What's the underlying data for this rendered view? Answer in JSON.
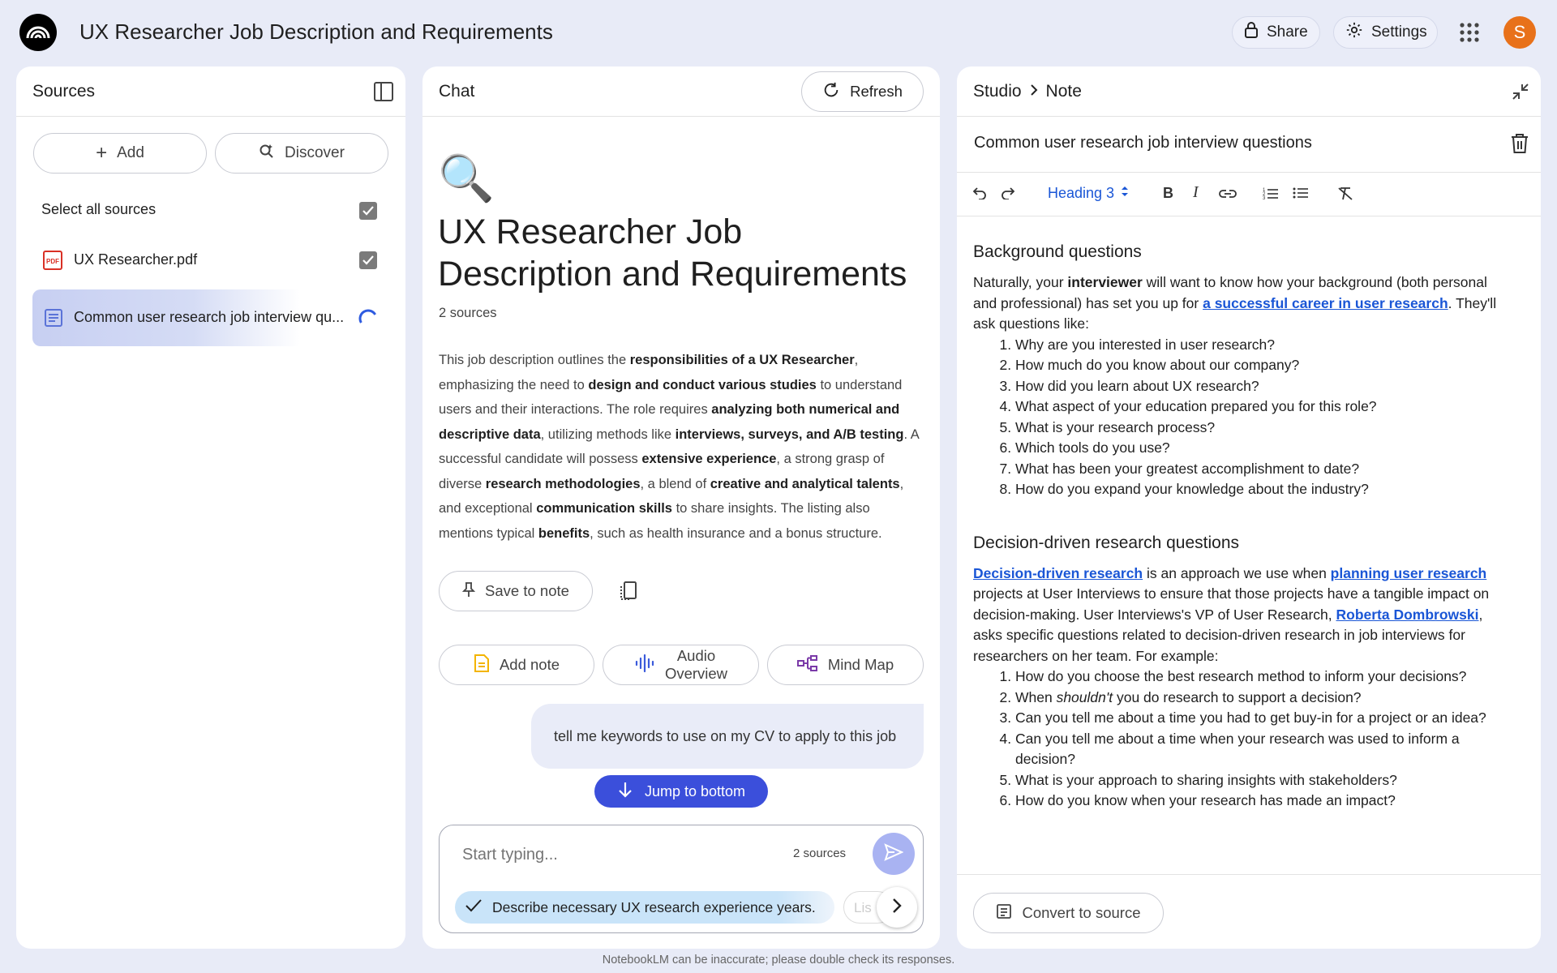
{
  "app": {
    "title": "UX Researcher Job Description and Requirements",
    "share_label": "Share",
    "settings_label": "Settings",
    "avatar_letter": "S",
    "accent": "#3b4fdb",
    "avatar_color": "#e8711a"
  },
  "sources": {
    "title": "Sources",
    "add_label": "Add",
    "discover_label": "Discover",
    "select_all_label": "Select all sources",
    "items": [
      {
        "name": "UX Researcher.pdf",
        "icon": "pdf-icon",
        "checked": true
      },
      {
        "name": "Common user research job interview qu...",
        "icon": "document-icon",
        "loading": true
      }
    ]
  },
  "chat": {
    "title": "Chat",
    "refresh_label": "Refresh",
    "emoji": "🔍",
    "heading": "UX Researcher Job Description and Requirements",
    "source_count": "2 sources",
    "save_to_note_label": "Save to note",
    "add_note_label": "Add note",
    "audio_overview_label_1": "Audio",
    "audio_overview_label_2": "Overview",
    "mind_map_label": "Mind Map",
    "user_message": "tell me keywords to use on my CV to apply to this job",
    "jump_label": "Jump to bottom",
    "input_placeholder": "Start typing...",
    "input_source_count": "2 sources",
    "suggestion": "Describe necessary UX research experience years.",
    "suggestion_next": "Lis"
  },
  "studio": {
    "breadcrumb_root": "Studio",
    "breadcrumb_leaf": "Note",
    "note_title": "Common user research job interview questions",
    "heading_select": "Heading 3",
    "section1_heading": "Background questions",
    "section1_p1a": "Naturally, your ",
    "section1_p1b": "interviewer",
    "section1_p1c": " will want to know how your background (both personal and professional) has set you up for ",
    "section1_link": "a successful career in user research",
    "section1_p1d": ". They'll ask questions like:",
    "section1_list": [
      "Why are you interested in user research?",
      "How much do you know about our company?",
      "How did you learn about UX research?",
      "What aspect of your education prepared you for this role?",
      "What is your research process?",
      "Which tools do you use?",
      "What has been your greatest accomplishment to date?",
      "How do you expand your knowledge about the industry?"
    ],
    "section2_heading": "Decision-driven research questions",
    "section2_link1": "Decision-driven research",
    "section2_p1": " is an approach we use when ",
    "section2_link2": "planning user research",
    "section2_p2": " projects at User Interviews to ensure that those projects have a tangible impact on decision-making. User Interviews's VP of User Research, ",
    "section2_link3": "Roberta Dombrowski",
    "section2_p3": ", asks specific questions related to decision-driven research in job interviews for researchers on her team. For example:",
    "section2_item2a": "When ",
    "section2_item2b": "shouldn't",
    "section2_item2c": " you do research to support a decision?",
    "section2_list": [
      "How do you choose the best research method to inform your decisions?",
      "Can you tell me about a time you had to get buy-in for a project or an idea?",
      "Can you tell me about a time when your research was used to inform a decision?",
      "What is your approach to sharing insights with stakeholders?",
      "How do you know when your research has made an impact?"
    ],
    "convert_label": "Convert to source"
  },
  "footer": "NotebookLM can be inaccurate; please double check its responses."
}
